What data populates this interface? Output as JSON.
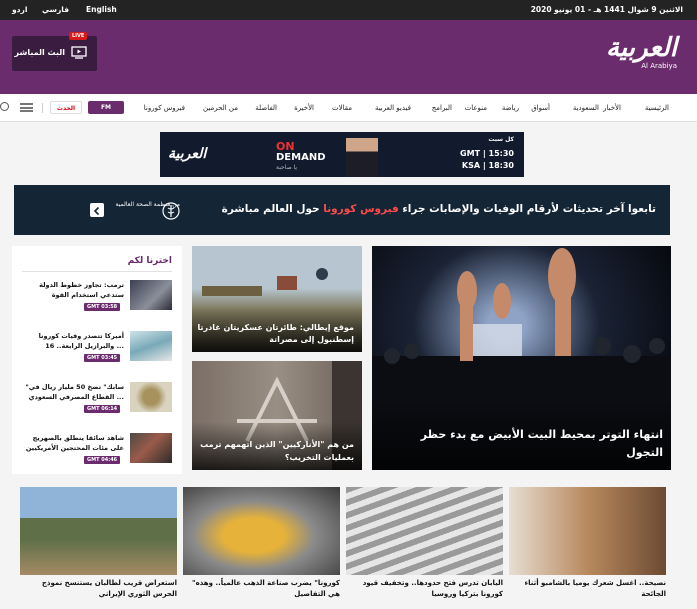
{
  "topbar": {
    "date": "الاثنين 9 شوال 1441 هـ - 01 يونيو 2020",
    "languages": [
      "English",
      "فارسي",
      "اردو"
    ]
  },
  "header": {
    "logo_ar": "العربية",
    "logo_en": "Al Arabiya",
    "live_badge": "LIVE",
    "live_label": "البث المباشر",
    "brand_color": "#6b2c6e"
  },
  "nav": {
    "items": [
      "الرئيسية",
      "الأخبار",
      "السعودية",
      "أسواق",
      "رياضة",
      "منوعات",
      "البرامج",
      "فيديو العربية",
      "مقالات",
      "الأخيرة",
      "الفاصلة",
      "من الحرمين",
      "فيروس كورونا"
    ],
    "fm_label": "FM",
    "hadath_label": "الحدث"
  },
  "ad": {
    "brand": "العربية",
    "on": "ON",
    "demand": "DEMAND",
    "sub": "يا صاحبة",
    "days": "كل سبت",
    "time1": "GMT | 15:30",
    "time2": "KSA | 18:30"
  },
  "banner": {
    "text_pre": "تابعوا آخر تحديثات لأرقام الوفيات والإصابات جراء ",
    "text_highlight": "فيروس كورونا",
    "text_post": " حول العالم مباشرة",
    "from": "من",
    "org": "منظمة الصحة العالمية"
  },
  "picks": {
    "title": "اخترنا لكم",
    "items": [
      {
        "title": "ترمب: تجاوز خطوط الدولة ستدعي استخدام القوة",
        "time": "GMT 03:58"
      },
      {
        "title": "أميركا تتصدر وفيات كورونا والبرازيل الرابعة.. 16 ...",
        "time": "GMT 03:45"
      },
      {
        "title": "\"سابك\" تضخ 50 مليار ريال في القطاع المصرفي السعودي ...",
        "time": "GMT 06:14"
      },
      {
        "title": "شاهد سائقا ينطلق بالصهريج على مئات المحتجين الأمريكيين",
        "time": "GMT 04:46"
      }
    ]
  },
  "stories": {
    "main": "انتهاء التوتر بمحيط البيت الأبيض مع بدء حظر التجول",
    "top": "موقع إيطالي: طائرتان عسكريتان غادرتا إسطنبول إلى مصراتة",
    "middle": "من هم \"الأناركيين\" الذين اتهمهم ترمب بعمليات التخريب؟"
  },
  "bottom": [
    {
      "title": "نصيحة.. اغسل شعرك يوميا بالشامبو أثناء الجائحة"
    },
    {
      "title": "اليابان تدرس فتح حدودها.. وتخفيف قيود كورونا بتركيا وروسيا"
    },
    {
      "title": "\"كورونا\" يضرب صناعة الذهب عالمياً.. وهذه هي التفاصيل"
    },
    {
      "title": "استعراض قريب لطالبان يستنسخ نموذج الحرس الثوري الإيراني"
    }
  ]
}
